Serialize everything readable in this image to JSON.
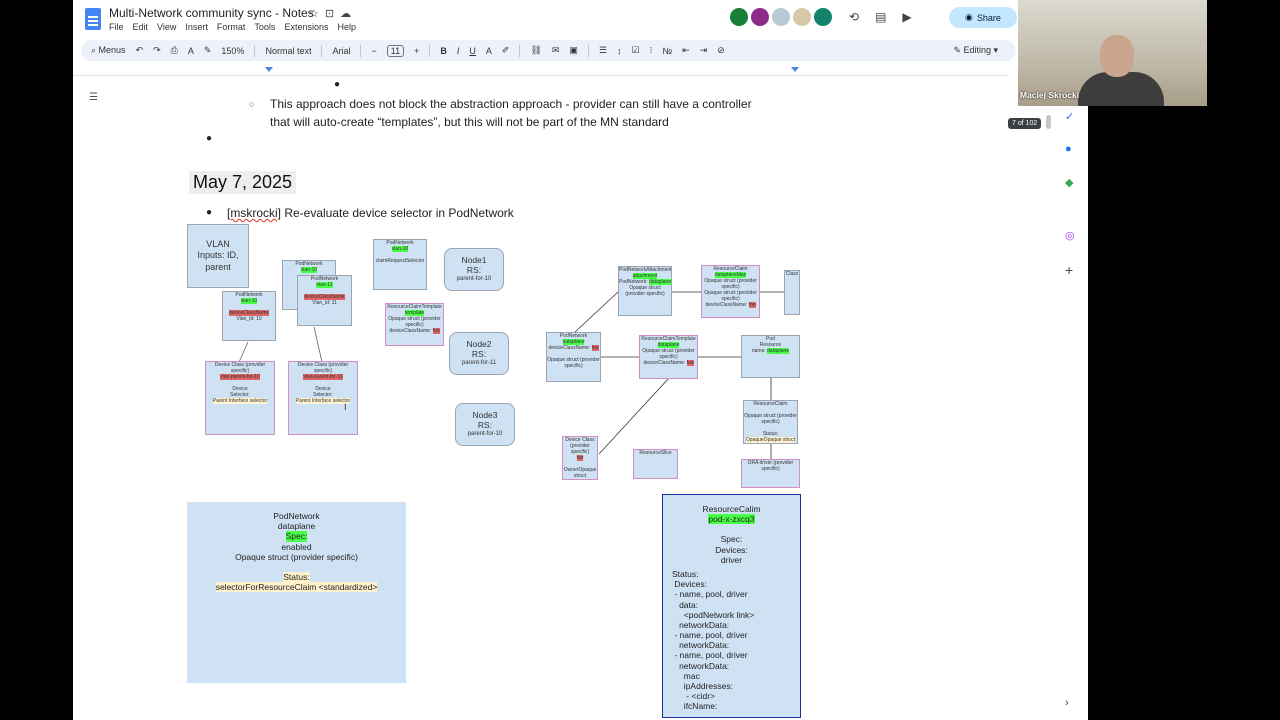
{
  "window": {
    "title": "Multi-Network community sync - Notes",
    "menus": [
      "File",
      "Edit",
      "View",
      "Insert",
      "Format",
      "Tools",
      "Extensions",
      "Help"
    ],
    "share_label": "Share"
  },
  "toolbar": {
    "menus_label": "Menus",
    "zoom": "150%",
    "style": "Normal text",
    "font": "Arial",
    "font_size": "11",
    "mode": "Editing"
  },
  "document": {
    "sub_bullet_line1": "This approach does not block the abstraction approach - provider can still have a controller",
    "sub_bullet_line2": "that will auto-create “templates”, but this will not be part of the MN standard",
    "date_heading": "May 7, 2025",
    "bullet_user": "[mskrocki]",
    "bullet_text": " Re-evaluate device selector in PodNetwork"
  },
  "diagram": {
    "vlan": [
      "VLAN",
      "Inputs: ID,",
      "parent"
    ],
    "node1": [
      "Node1",
      "RS:",
      "parent-for-10"
    ],
    "node2": [
      "Node2",
      "RS:",
      "parent-for-11"
    ],
    "node3": [
      "Node3",
      "RS:",
      "parent-for-10"
    ],
    "podnetwork": {
      "title": "PodNetwork",
      "name": "dataplane",
      "spec": "Spec:",
      "enabled": "enabled",
      "opaque": "Opaque struct (provider specific)",
      "status": "Status:",
      "selector": "selectorForResourceClaim <standardized>"
    },
    "resourceclaim": {
      "title": "ResourceCalim",
      "name": "pod-x-zxcq3",
      "spec": "Spec:",
      "devices": "Devices:",
      "driver": "driver",
      "status_lines": [
        "Status:",
        " Devices:",
        " - name, pool, driver",
        "   data:",
        "     <podNetwork link>",
        "   networkData:",
        " - name, pool, driver",
        "   networkData:",
        " - name, pool, driver",
        "   networkData:",
        "     mac",
        "     ipAddresses:",
        "      - <cidr>",
        "     ifcName:"
      ]
    }
  },
  "side": {
    "page_indicator": "7 of 102",
    "participant_name": "Maciej Skrocki"
  },
  "colors": {
    "accent": "#4285f4",
    "share_bg": "#c2e7ff",
    "box_fill": "#cfe2f3",
    "highlight_green": "#48ff48"
  }
}
